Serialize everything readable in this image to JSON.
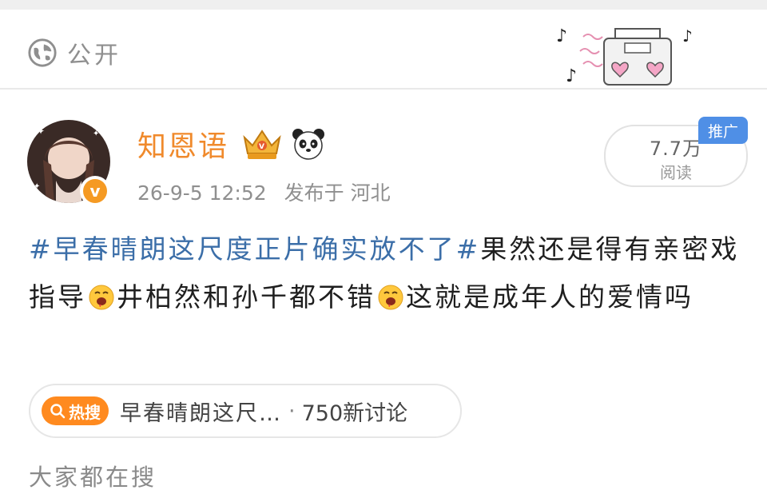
{
  "header": {
    "visibility_label": "公开",
    "visibility_icon": "globe-icon",
    "decoration_icon": "boombox-music-icon"
  },
  "post": {
    "author": {
      "name": "知恩语",
      "avatar_icon": "avatar-image",
      "verified_icon": "verified-v-icon",
      "badges": [
        "crown-badge-icon",
        "panda-icon"
      ]
    },
    "timestamp": "26-9-5 12:52",
    "published_from": "发布于 河北",
    "reads": {
      "count": "7.7万",
      "label": "阅读",
      "promo_badge": "推广"
    },
    "body": {
      "tag": "#早春晴朗这尺度正片确实放不了#",
      "text1": "果然还是得有亲密戏指导",
      "text2": "井柏然和孙千都不错",
      "text3": "这就是成年人的爱情吗",
      "emoji_icon": "drooling-face-emoji"
    },
    "hot_search": {
      "badge_label": "热搜",
      "topic": "早春晴朗这尺…",
      "separator": "·",
      "discussion_count": "750新讨论"
    }
  },
  "section": {
    "everyone_searching": "大家都在搜"
  },
  "colors": {
    "username": "#f08a2c",
    "hashtag": "#3b6ea8",
    "hot_badge": "#ff8a1f",
    "promo_badge": "#4f8fe6",
    "meta_text": "#8f8f8f"
  }
}
